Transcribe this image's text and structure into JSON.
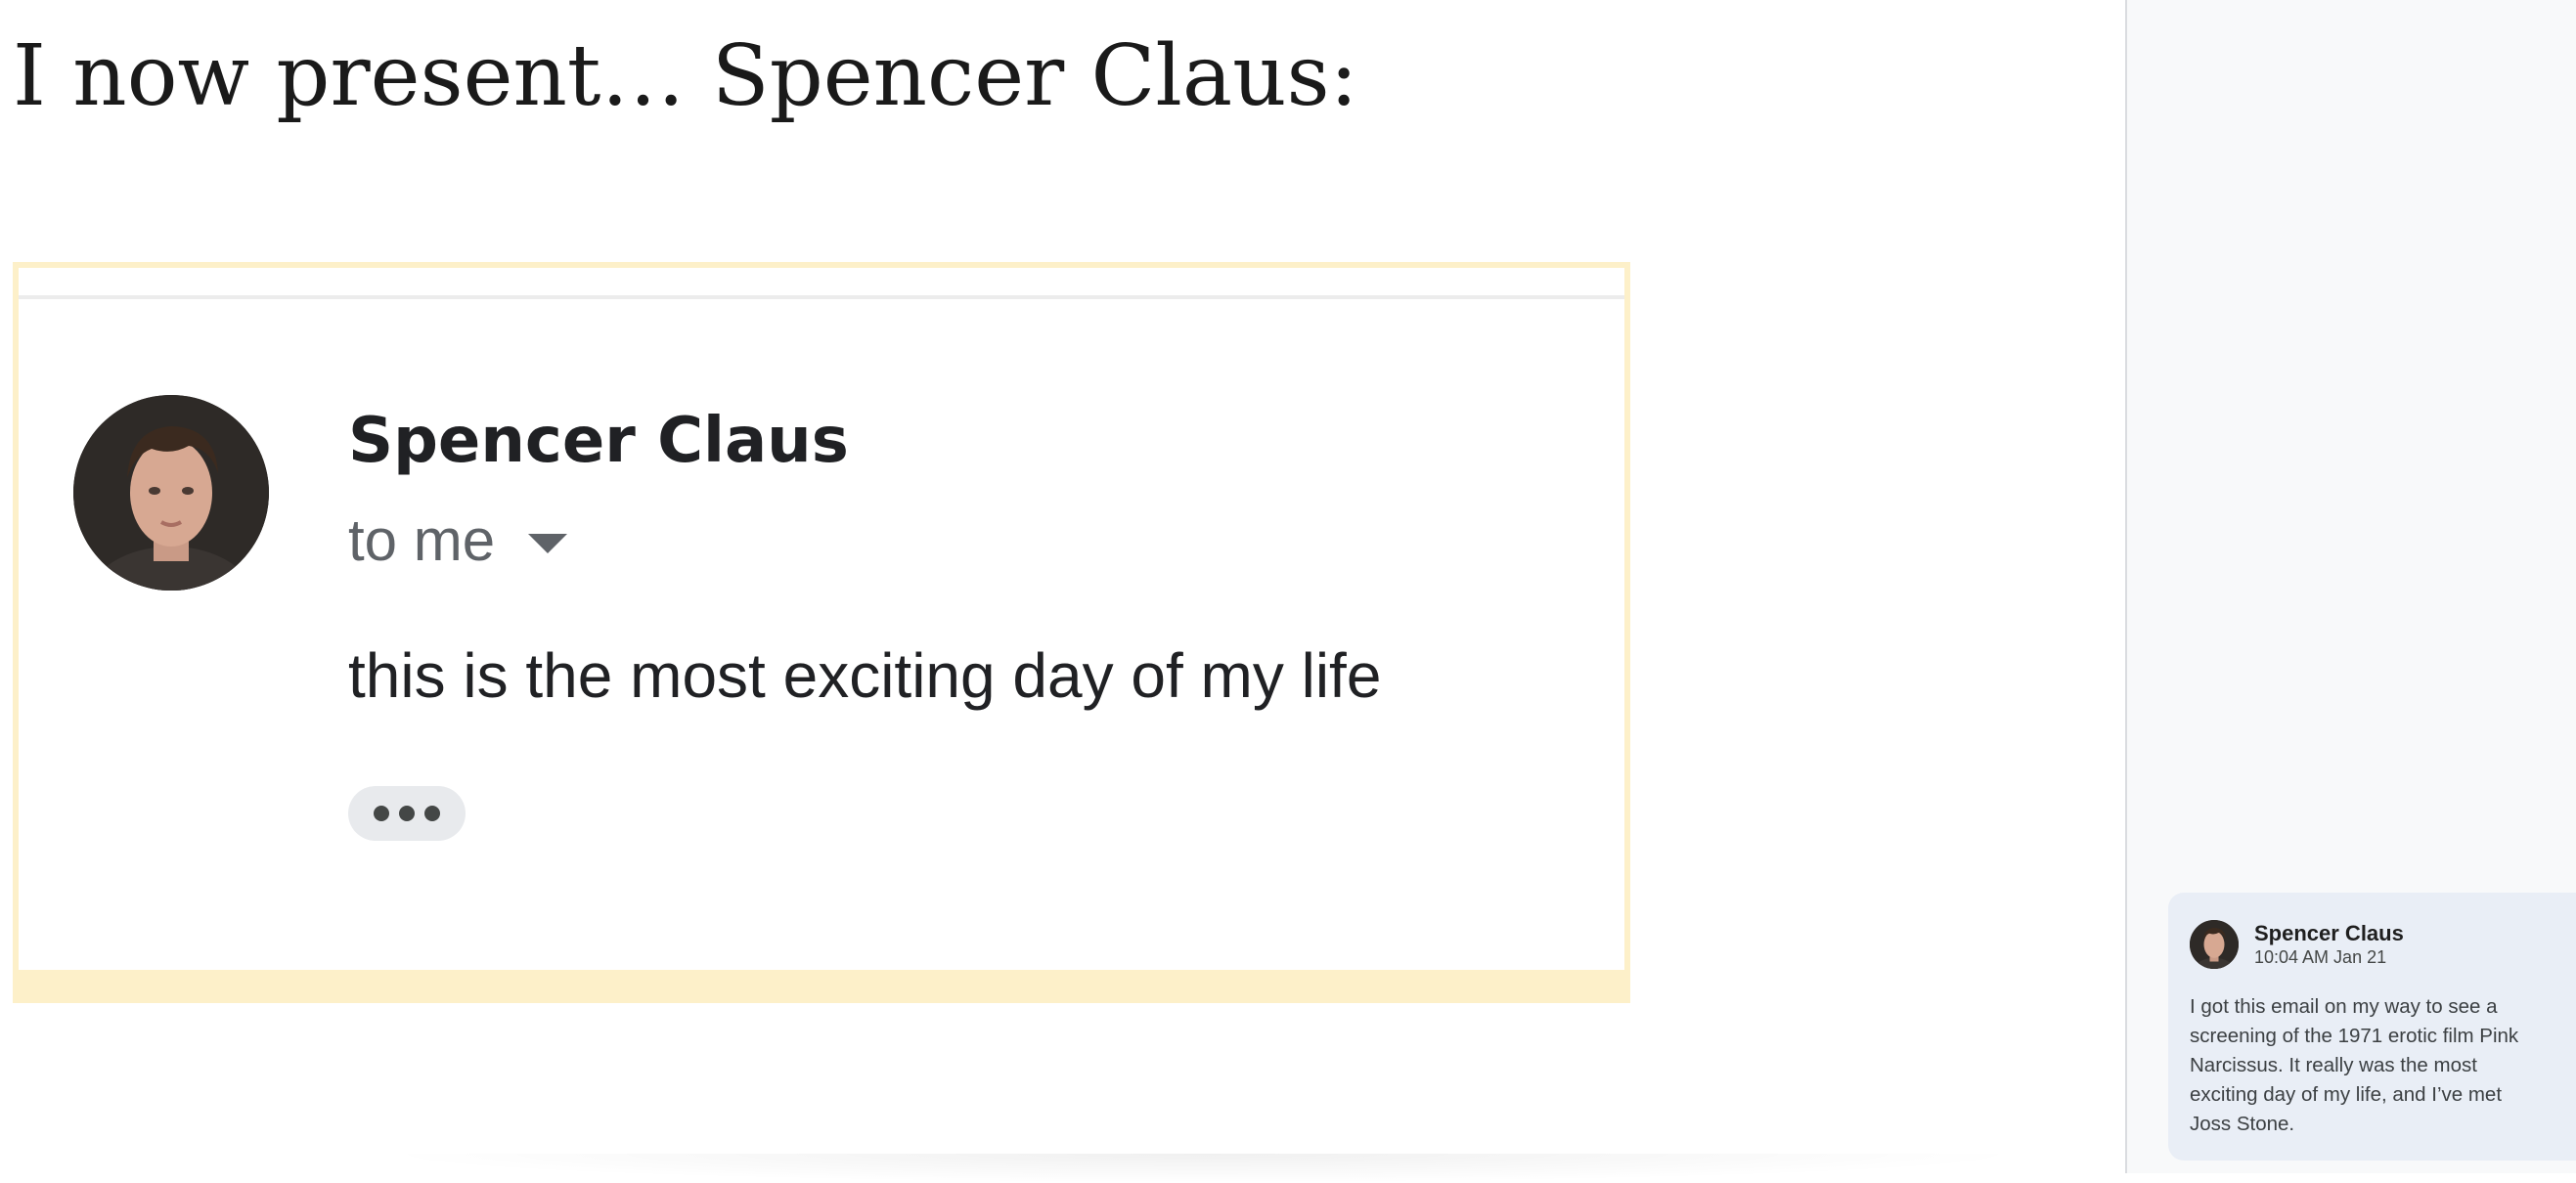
{
  "document": {
    "heading": "I now present… Spencer Claus:"
  },
  "embedded_email": {
    "sender_name": "Spencer Claus",
    "recipient_label": "to me",
    "body_text": "this is the most exciting day of my life",
    "avatar_icon": "person-portrait-icon",
    "more_icon": "ellipsis-icon"
  },
  "comments": [
    {
      "author": "Spencer Claus",
      "timestamp": "10:04 AM Jan 21",
      "text": "I got this email on my way to see a screening of the 1971 erotic film Pink Narcissus. It really was the most exciting day of my life, and I’ve met Joss Stone."
    }
  ],
  "colors": {
    "image_border": "#fdf0c9",
    "comment_card_bg": "#e9eef6",
    "panel_bg": "#f8f9fa"
  }
}
